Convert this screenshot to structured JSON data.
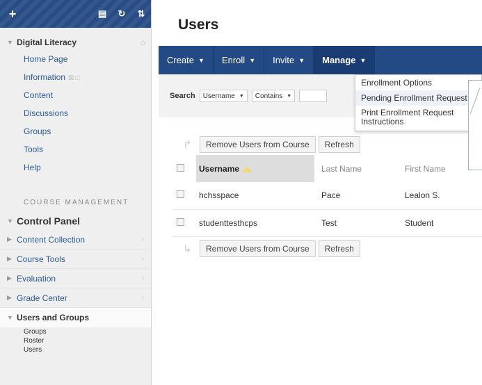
{
  "sidebar": {
    "toolbar": {
      "add_glyph": "+",
      "folder_glyph": "▤",
      "refresh_glyph": "↻",
      "sort_glyph": "⇅"
    },
    "course_title": "Digital Literacy",
    "menu": [
      {
        "label": "Home Page"
      },
      {
        "label": "Information",
        "extra": "☒ □"
      },
      {
        "label": "Content"
      },
      {
        "label": "Discussions"
      },
      {
        "label": "Groups"
      },
      {
        "label": "Tools"
      },
      {
        "label": "Help"
      }
    ],
    "course_management_label": "COURSE MANAGEMENT",
    "control_panel_label": "Control Panel",
    "cp_items": [
      {
        "label": "Content Collection"
      },
      {
        "label": "Course Tools"
      },
      {
        "label": "Evaluation"
      },
      {
        "label": "Grade Center"
      }
    ],
    "users_groups_label": "Users and Groups",
    "users_groups_sub": [
      "Groups",
      "Roster",
      "Users"
    ]
  },
  "main": {
    "page_title": "Users",
    "action_bar": [
      {
        "label": "Create"
      },
      {
        "label": "Enroll"
      },
      {
        "label": "Invite"
      },
      {
        "label": "Manage"
      }
    ],
    "manage_menu": [
      "Enrollment Options",
      "Pending Enrollment Request",
      "Print Enrollment Request Instructions"
    ],
    "search": {
      "label": "Search",
      "field": "Username",
      "operator": "Contains"
    },
    "bulk_actions": {
      "remove_label": "Remove Users from Course",
      "refresh_label": "Refresh"
    },
    "table": {
      "columns": [
        "Username",
        "Last Name",
        "First Name"
      ],
      "rows": [
        [
          "hchsspace",
          "Pace",
          "Lealon S."
        ],
        [
          "studenttesthcps",
          "Test",
          "Student"
        ]
      ]
    }
  },
  "colors": {
    "action_bar": "#234a84",
    "link": "#2a5a9a",
    "sidebar_bg": "#efefef"
  }
}
